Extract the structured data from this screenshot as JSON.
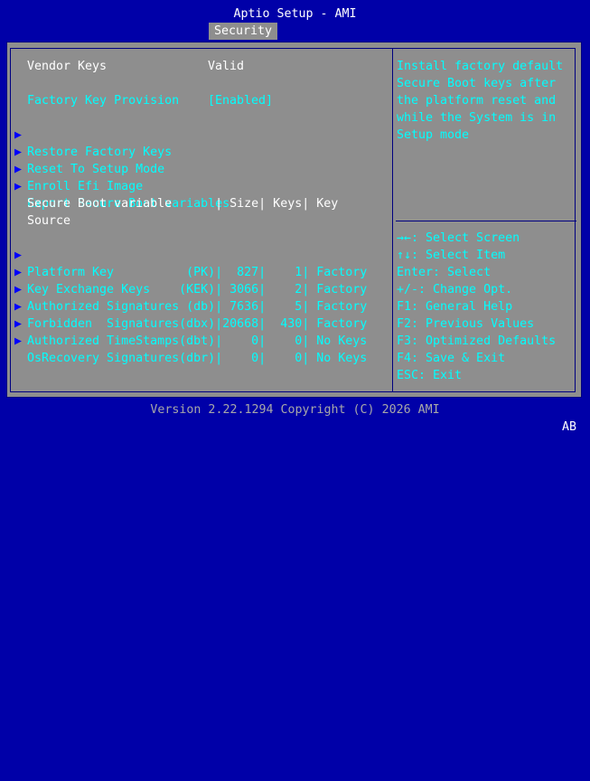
{
  "header": {
    "title": "Aptio Setup - AMI",
    "active_tab": "Security"
  },
  "main": {
    "vendor_keys": {
      "label": "Vendor Keys",
      "value": "Valid"
    },
    "factory_key_provision": {
      "label": "Factory Key Provision",
      "value": "[Enabled]"
    },
    "menu_items": [
      "Restore Factory Keys",
      "Reset To Setup Mode",
      "Enroll Efi Image",
      "Export Secure Boot variables"
    ],
    "table_header": {
      "line1": "Secure Boot variable      | Size| Keys| Key",
      "line2": "Source"
    },
    "table_rows": [
      "Platform Key          (PK)|  827|    1| Factory",
      "Key Exchange Keys    (KEK)| 3066|    2| Factory",
      "Authorized Signatures (db)| 7636|    5| Factory",
      "Forbidden  Signatures(dbx)|20668|  430| Factory",
      "Authorized TimeStamps(dbt)|    0|    0| No Keys",
      "OsRecovery Signatures(dbr)|    0|    0| No Keys"
    ]
  },
  "help": {
    "description": [
      "Install factory default",
      "Secure Boot keys after",
      "the platform reset and",
      "while the System is in",
      "Setup mode"
    ],
    "keys": [
      "→←: Select Screen",
      "↑↓: Select Item",
      "Enter: Select",
      "+/-: Change Opt.",
      "F1: General Help",
      "F2: Previous Values",
      "F3: Optimized Defaults",
      "F4: Save & Exit",
      "ESC: Exit"
    ]
  },
  "footer": {
    "version": "Version 2.22.1294 Copyright (C) 2026 AMI",
    "indicator": "AB"
  },
  "icons": {
    "submenu_arrow": "▶"
  },
  "colors": {
    "background": "#0000a8",
    "panel": "#8e8e8e",
    "text_white": "#ffffff",
    "text_cyan": "#00ffff",
    "arrow_blue": "#0000ff"
  }
}
